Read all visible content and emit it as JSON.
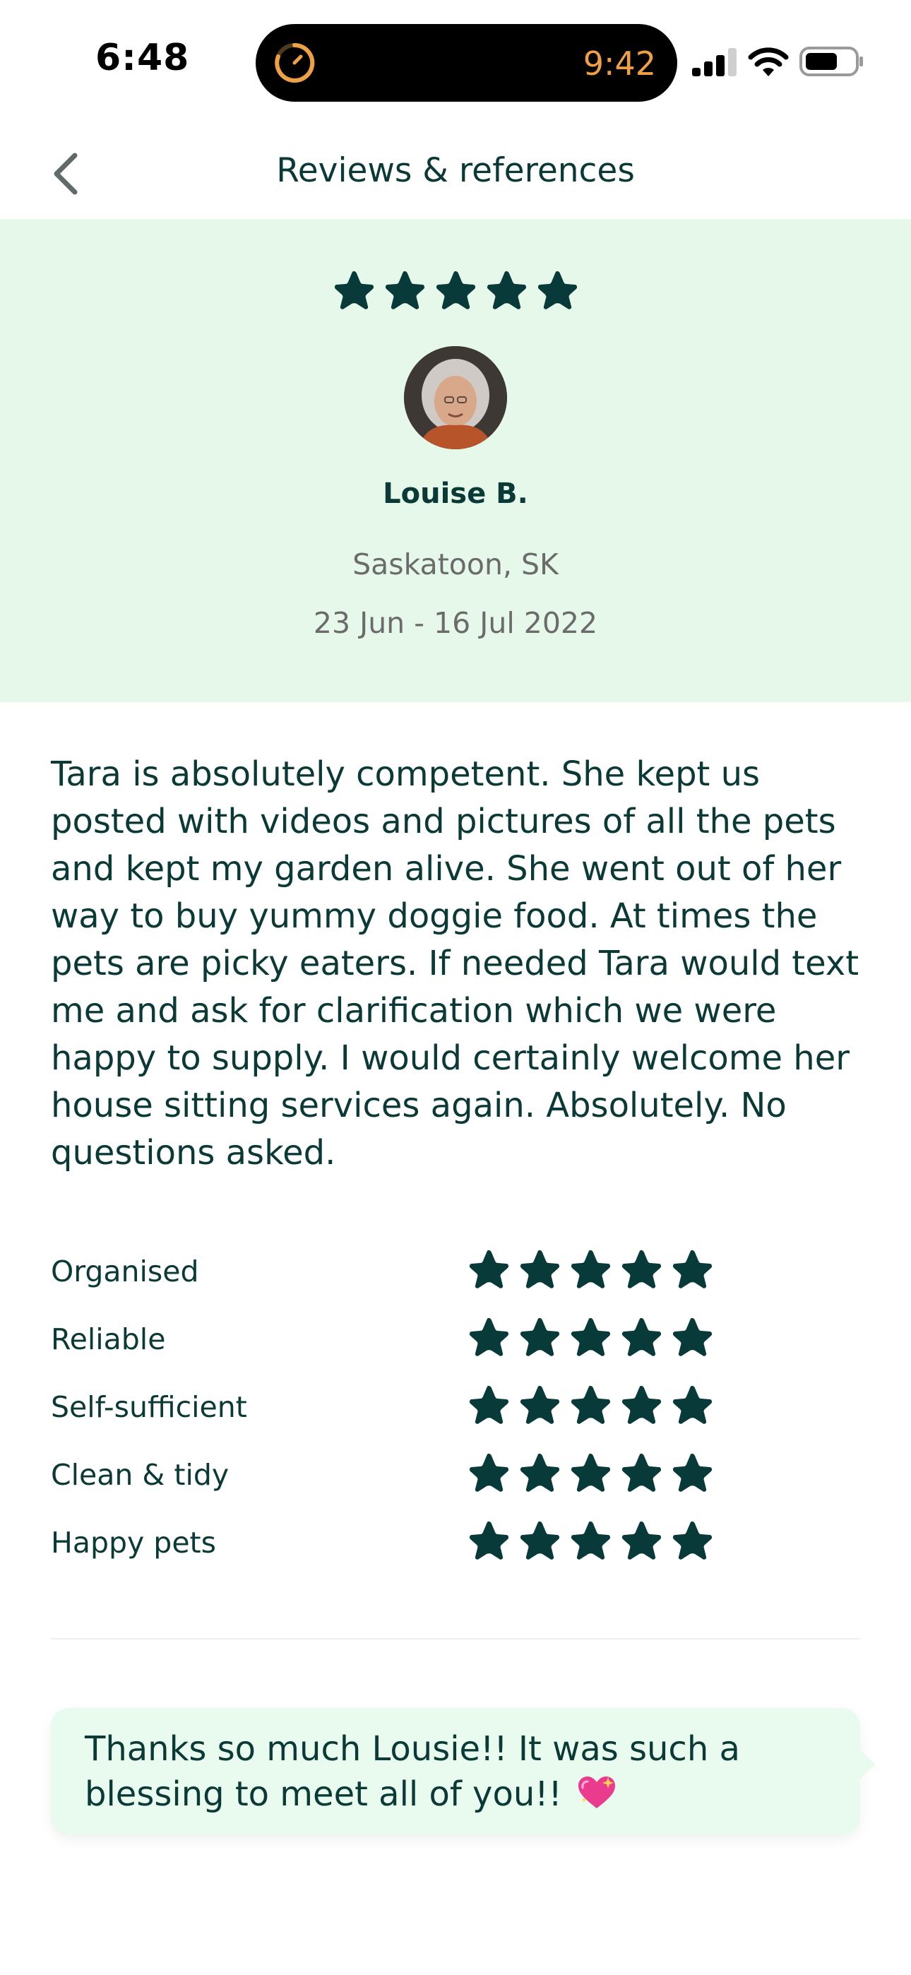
{
  "status_bar": {
    "time": "6:48",
    "island_timer": "9:42"
  },
  "nav": {
    "title": "Reviews & references"
  },
  "review": {
    "overall_rating": 5,
    "reviewer_name": "Louise B.",
    "location": "Saskatoon, SK",
    "dates": "23 Jun - 16 Jul 2022",
    "text": "Tara is absolutely competent. She kept us posted with videos and pictures of all the pets and kept my garden alive. She went out of her way to buy yummy doggie food. At times the pets are picky eaters. If needed Tara would text me and ask for clarification which we were happy to supply. I would certainly welcome her house sitting services again. Absolutely. No questions asked."
  },
  "ratings": [
    {
      "label": "Organised",
      "stars": 5
    },
    {
      "label": "Reliable",
      "stars": 5
    },
    {
      "label": "Self-sufficient",
      "stars": 5
    },
    {
      "label": "Clean & tidy",
      "stars": 5
    },
    {
      "label": "Happy pets",
      "stars": 5
    }
  ],
  "reply": {
    "text": "Thanks so much Lousie!!  It was such a blessing to meet all of you!!",
    "emoji_icon": "sparkling-heart-icon"
  },
  "colors": {
    "star": "#073a38",
    "header_bg": "#e5f8e9",
    "reply_bg": "#e8fbee",
    "text": "#0b3a36",
    "muted": "#6b6b6b",
    "timer": "#f0a044"
  }
}
